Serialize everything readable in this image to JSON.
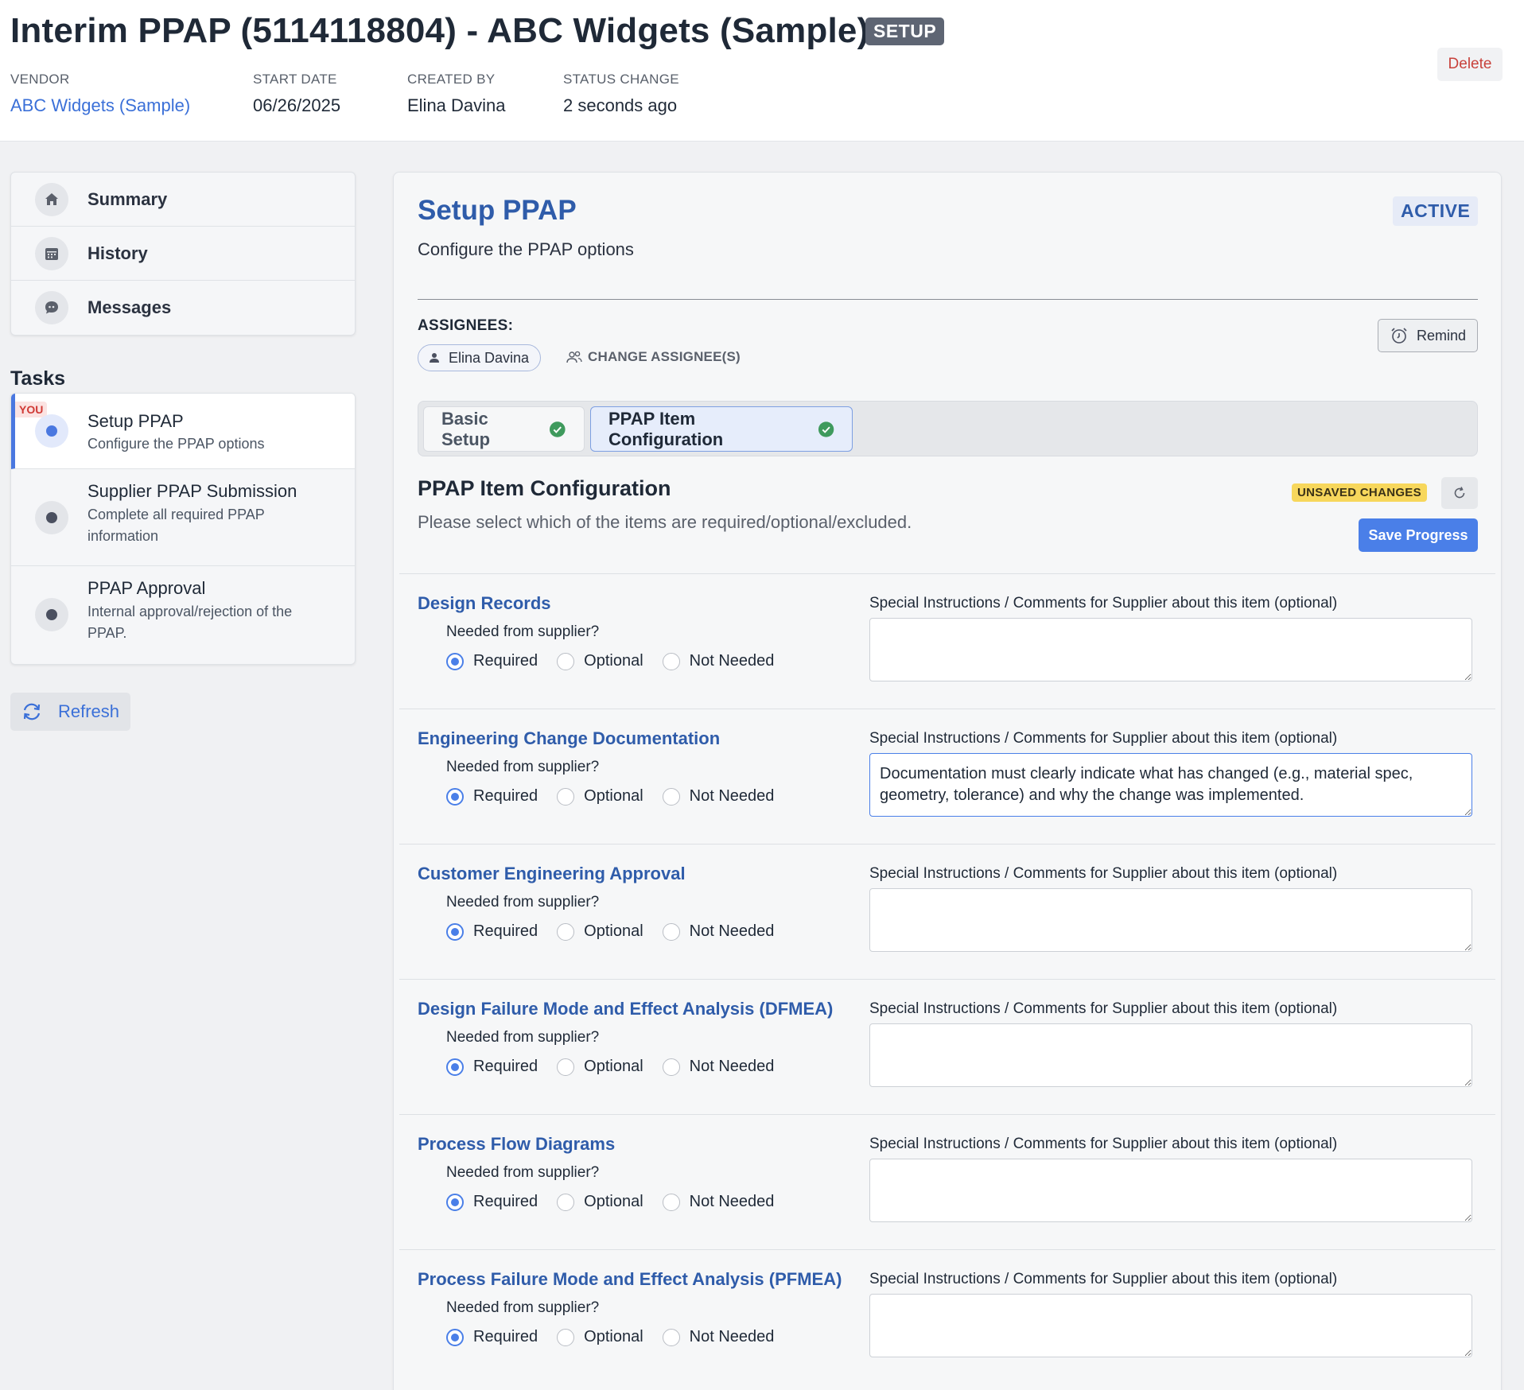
{
  "header": {
    "title": "Interim PPAP (5114118804) - ABC Widgets (Sample)",
    "status_badge": "SETUP",
    "delete_label": "Delete",
    "meta": {
      "vendor_label": "VENDOR",
      "vendor_value": "ABC Widgets (Sample)",
      "start_date_label": "START DATE",
      "start_date_value": "06/26/2025",
      "created_by_label": "CREATED BY",
      "created_by_value": "Elina Davina",
      "status_change_label": "STATUS CHANGE",
      "status_change_value": "2 seconds ago"
    }
  },
  "sidebar": {
    "nav": [
      {
        "label": "Summary",
        "icon": "home-icon"
      },
      {
        "label": "History",
        "icon": "calendar-icon"
      },
      {
        "label": "Messages",
        "icon": "chat-icon"
      }
    ],
    "tasks_title": "Tasks",
    "tasks": [
      {
        "name": "Setup PPAP",
        "desc": "Configure the PPAP options",
        "active": true,
        "badge": "YOU"
      },
      {
        "name": "Supplier PPAP Submission",
        "desc": "Complete all required PPAP information",
        "active": false
      },
      {
        "name": "PPAP Approval",
        "desc": "Internal approval/rejection of the PPAP.",
        "active": false
      }
    ],
    "refresh_label": "Refresh"
  },
  "main": {
    "title": "Setup PPAP",
    "subtitle": "Configure the PPAP options",
    "status": "ACTIVE",
    "assignees_label": "ASSIGNEES:",
    "assignee": "Elina Davina",
    "change_assignee_label": "CHANGE ASSIGNEE(S)",
    "remind_label": "Remind",
    "tabs": [
      {
        "label": "Basic Setup",
        "complete": true,
        "selected": false
      },
      {
        "label": "PPAP Item Configuration",
        "complete": true,
        "selected": true
      }
    ],
    "config_title": "PPAP Item Configuration",
    "config_subtitle": "Please select which of the items are required/optional/excluded.",
    "unsaved_label": "UNSAVED CHANGES",
    "save_label": "Save Progress",
    "needed_label": "Needed from supplier?",
    "comment_label": "Special Instructions / Comments for Supplier about this item (optional)",
    "options": [
      "Required",
      "Optional",
      "Not Needed"
    ],
    "items": [
      {
        "title": "Design Records",
        "selected": "Required",
        "comment": ""
      },
      {
        "title": "Engineering Change Documentation",
        "selected": "Required",
        "comment": "Documentation must clearly indicate what has changed (e.g., material spec, geometry, tolerance) and why the change was implemented."
      },
      {
        "title": "Customer Engineering Approval",
        "selected": "Required",
        "comment": ""
      },
      {
        "title": "Design Failure Mode and Effect Analysis (DFMEA)",
        "selected": "Required",
        "comment": ""
      },
      {
        "title": "Process Flow Diagrams",
        "selected": "Required",
        "comment": ""
      },
      {
        "title": "Process Failure Mode and Effect Analysis (PFMEA)",
        "selected": "Required",
        "comment": ""
      }
    ]
  },
  "colors": {
    "accent": "#4a7fe8",
    "title_blue": "#2f5caa",
    "unsaved": "#f7d75c",
    "delete": "#c8413b",
    "success": "#3f9a5d"
  }
}
